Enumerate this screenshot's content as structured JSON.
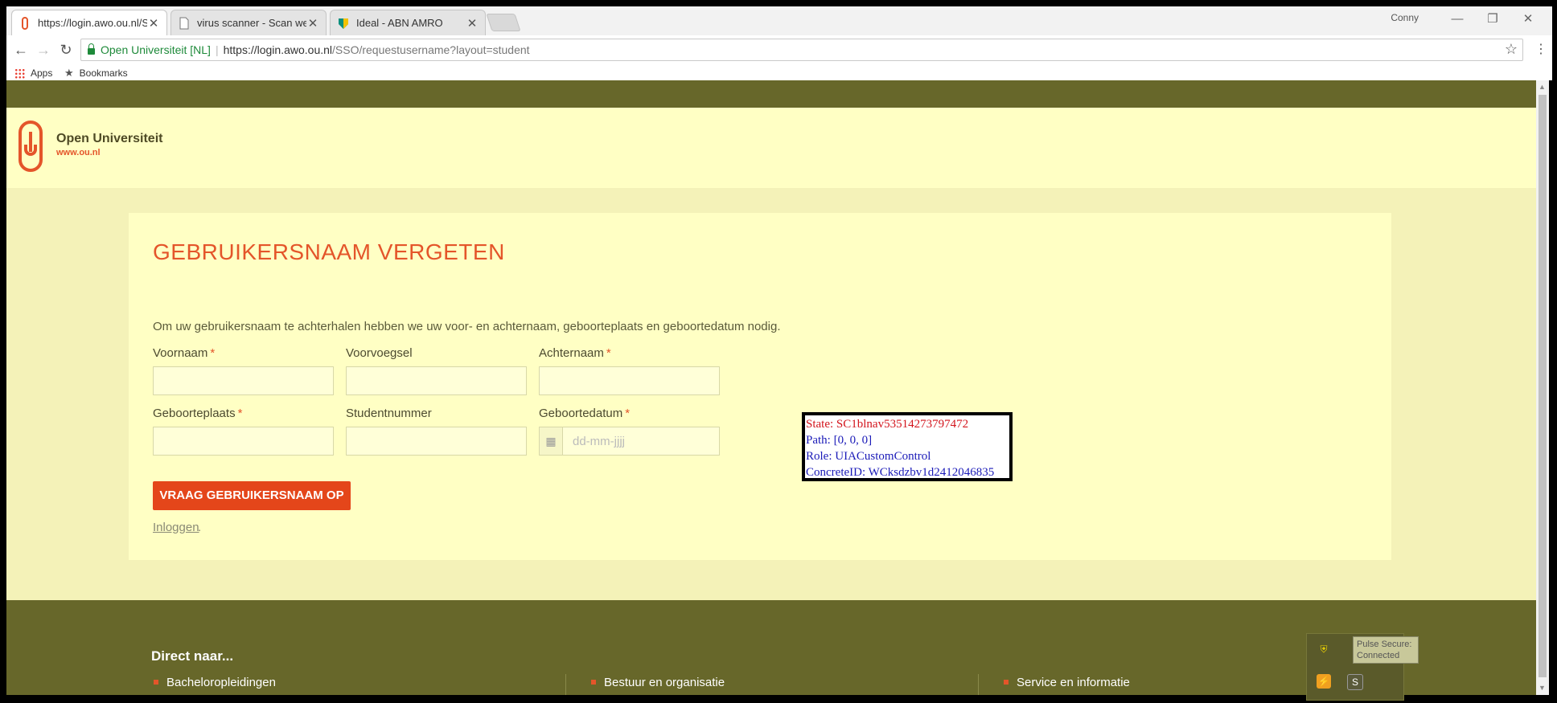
{
  "browser": {
    "tabs": [
      {
        "title": "https://login.awo.ou.nl/S",
        "icon": "ou-favicon-icon"
      },
      {
        "title": "virus scanner - Scan web",
        "icon": "page-icon"
      },
      {
        "title": "Ideal - ABN AMRO",
        "icon": "abn-amro-icon"
      }
    ],
    "profile_name": "Conny",
    "site_name": "Open Universiteit [NL]",
    "url_host": "https://login.awo.ou.nl",
    "url_path": "/SSO/requestusername?layout=student",
    "bookmarks": {
      "apps": "Apps",
      "bookmarks": "Bookmarks"
    }
  },
  "site": {
    "logo_name": "Open Universiteit",
    "logo_url": "www.ou.nl"
  },
  "form": {
    "heading": "GEBRUIKERSNAAM VERGETEN",
    "intro": "Om uw gebruikersnaam te achterhalen hebben we uw voor- en achternaam, geboorteplaats en geboortedatum nodig.",
    "fields": {
      "voornaam": "Voornaam",
      "voorvoegsel": "Voorvoegsel",
      "achternaam": "Achternaam",
      "geboorteplaats": "Geboorteplaats",
      "studentnummer": "Studentnummer",
      "geboortedatum": "Geboortedatum"
    },
    "required_marker": "*",
    "date_placeholder": "dd-mm-jjjj",
    "submit_label": "VRAAG GEBRUIKERSNAAM OP",
    "login_link": "Inloggen",
    "login_link_suffix": "."
  },
  "footer": {
    "heading": "Direct naar...",
    "columns": [
      "Bacheloropleidingen",
      "Bestuur en organisatie",
      "Service en informatie"
    ]
  },
  "overlay": {
    "state": "State: SC1blnav53514273797472",
    "path": "Path: [0, 0, 0]",
    "role": "Role: UIACustomControl",
    "concrete_id": "ConcreteID: WCksdzbv1d2412046835"
  },
  "tray": {
    "tooltip_line1": "Pulse Secure:",
    "tooltip_line2": "Connected"
  },
  "colors": {
    "brand_orange": "#e4552a",
    "olive": "#67672a",
    "cream": "#ffffc4"
  }
}
